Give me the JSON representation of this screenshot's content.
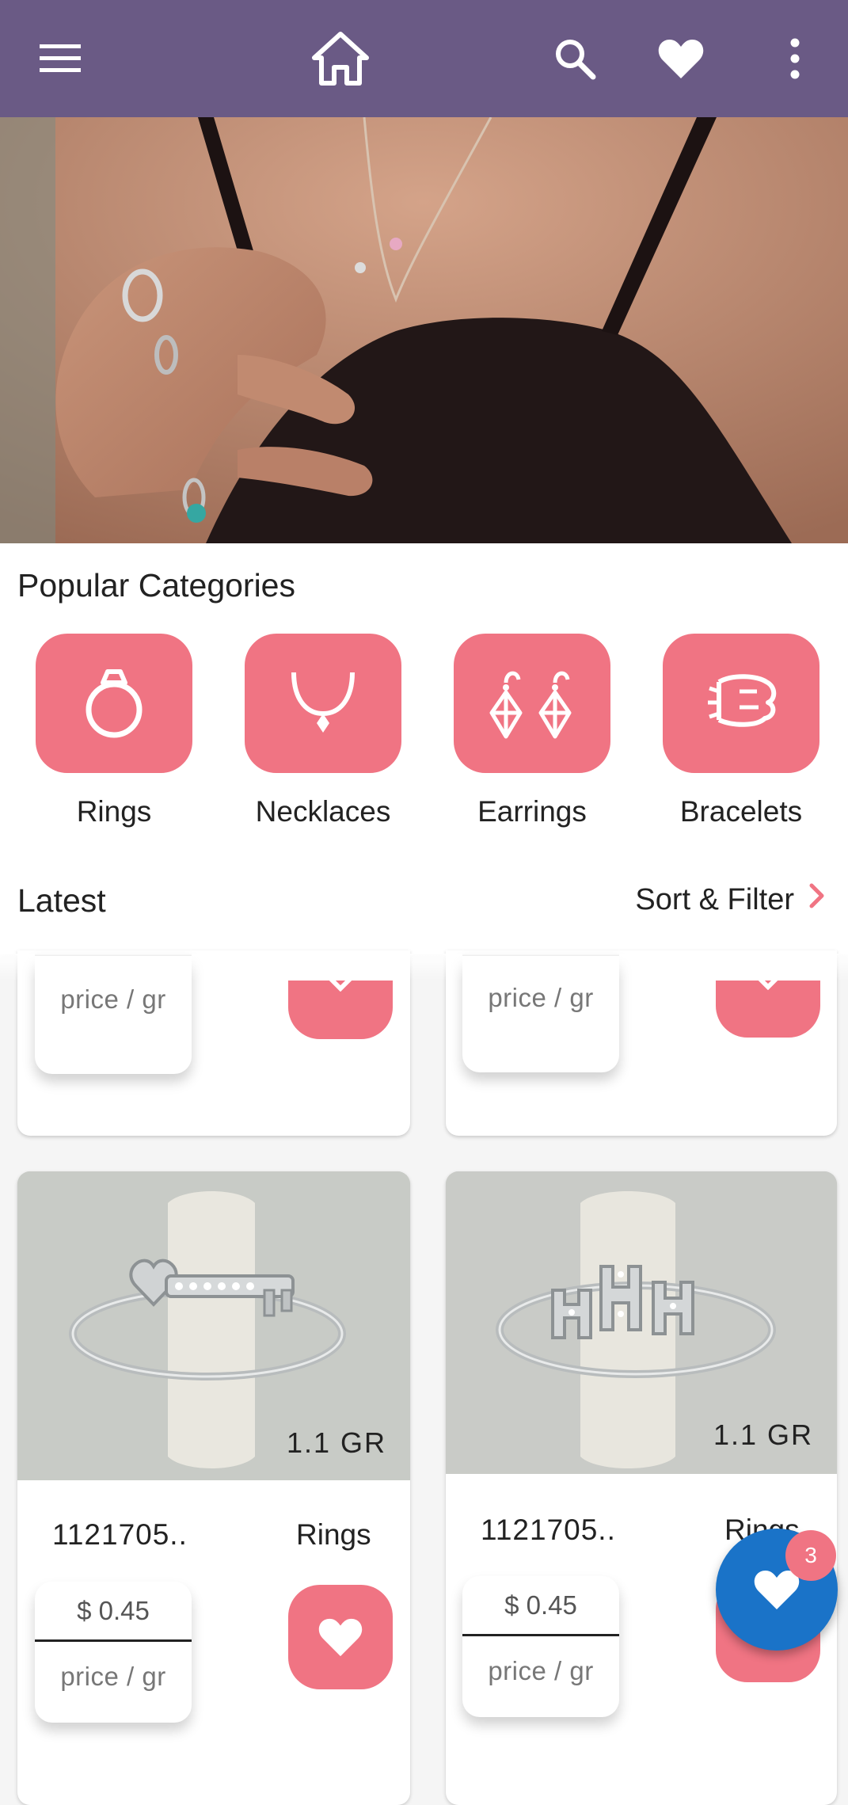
{
  "appbar": {
    "icons": [
      "menu-icon",
      "home-icon",
      "search-icon",
      "heart-icon",
      "more-vert-icon"
    ],
    "color": "#6a5a85"
  },
  "categories": {
    "title": "Popular Categories",
    "items": [
      {
        "label": "Rings",
        "icon": "ring-icon"
      },
      {
        "label": "Necklaces",
        "icon": "necklace-icon"
      },
      {
        "label": "Earrings",
        "icon": "earrings-icon"
      },
      {
        "label": "Bracelets",
        "icon": "bracelet-icon"
      }
    ],
    "tile_color": "#f07483"
  },
  "latest": {
    "title": "Latest",
    "sort_label": "Sort & Filter"
  },
  "products_partial": [
    {
      "price_unit": "price / gr"
    },
    {
      "price_unit": "price / gr"
    }
  ],
  "products": [
    {
      "weight": "1.1 GR",
      "code": "1121705..",
      "category": "Rings",
      "price": "$ 0.45",
      "price_unit": "price / gr"
    },
    {
      "weight": "1.1 GR",
      "code": "1121705..",
      "category": "Rings",
      "price": "$ 0.45",
      "price_unit": "price / gr"
    }
  ],
  "fab": {
    "badge": "3",
    "icon": "heart-icon",
    "color": "#1a73c8"
  }
}
